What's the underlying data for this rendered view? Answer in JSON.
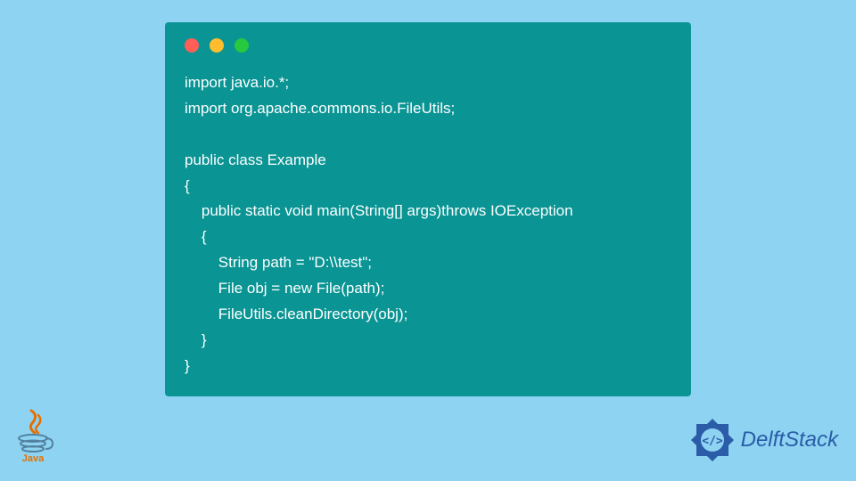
{
  "code": {
    "line1": "import java.io.*;",
    "line2": "import org.apache.commons.io.FileUtils;",
    "line3": "",
    "line4": "public class Example",
    "line5": "{",
    "line6": "    public static void main(String[] args)throws IOException",
    "line7": "    {",
    "line8": "        String path = \"D:\\\\test\";",
    "line9": "        File obj = new File(path);",
    "line10": "        FileUtils.cleanDirectory(obj);",
    "line11": "    }",
    "line12": "}"
  },
  "logos": {
    "java_label": "Java",
    "delft_label": "DelftStack"
  },
  "colors": {
    "background": "#8ed4f2",
    "window": "#0a9494",
    "dot_red": "#ff5f56",
    "dot_yellow": "#ffbd2e",
    "dot_green": "#27c93f",
    "code_text": "#ffffff",
    "delft_blue": "#2a5ca8",
    "java_red": "#e76f00"
  }
}
